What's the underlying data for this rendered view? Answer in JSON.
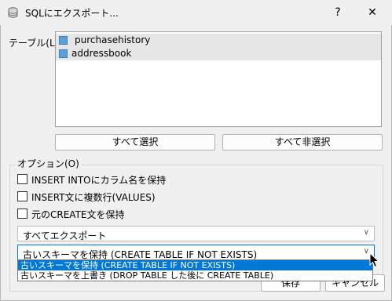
{
  "window": {
    "title": "SQLにエクスポート...",
    "help_label": "?",
    "close_label": "✕"
  },
  "tables": {
    "label": "テーブル(L)",
    "items": [
      "purchasehistory",
      "addressbook"
    ]
  },
  "buttons": {
    "select_all": "すべて選択",
    "deselect_all": "すべて非選択",
    "save": "保存",
    "cancel": "キャンセル"
  },
  "options": {
    "label": "オプション(O)",
    "checkbox1": "INSERT INTOにカラム名を保持",
    "checkbox2": "INSERT文に複数行(VALUES)",
    "checkbox3": "元のCREATE文を保持",
    "export_scope": "すべてエクスポート",
    "schema_mode": "古いスキーマを保持 (CREATE TABLE IF NOT EXISTS)",
    "schema_options": [
      "古いスキーマを保持 (CREATE TABLE IF NOT EXISTS)",
      "古いスキーマを上書き (DROP TABLE した後に CREATE TABLE)"
    ]
  },
  "colors": {
    "accent": "#0078d7",
    "selected_text": "#ffffff"
  }
}
